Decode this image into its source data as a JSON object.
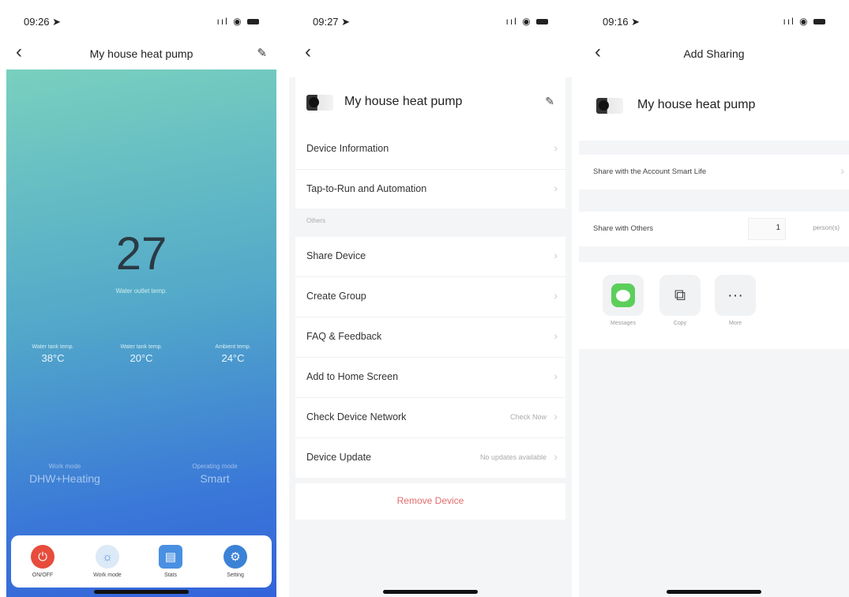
{
  "screen1": {
    "status": {
      "time": "09:26 ➤"
    },
    "nav": {
      "title": "My house heat pump"
    },
    "temperature": "27",
    "temperature_sublabel": "Water outlet temp.",
    "metrics": [
      {
        "label": "Water tank temp.",
        "value": "38°C"
      },
      {
        "label": "Water tank temp.",
        "value": "20°C"
      },
      {
        "label": "Ambient temp.",
        "value": "24°C"
      }
    ],
    "modes": [
      {
        "label": "Work mode",
        "value": "DHW+Heating"
      },
      {
        "label": "Operating mode",
        "value": "Smart"
      }
    ],
    "tabs": [
      {
        "label": "ON/OFF",
        "color": "#e74c3c"
      },
      {
        "label": "Work mode",
        "color": "#dce9f7"
      },
      {
        "label": "Stats",
        "color": "#4a90e2"
      },
      {
        "label": "Setting",
        "color": "#3b82d6"
      }
    ]
  },
  "screen2": {
    "status": {
      "time": "09:27 ➤"
    },
    "device_name": "My house heat pump",
    "items_top": [
      {
        "label": "Device Information"
      },
      {
        "label": "Tap-to-Run and Automation"
      }
    ],
    "section_title": "Others",
    "items_others": [
      {
        "label": "Share Device",
        "value": ""
      },
      {
        "label": "Create Group",
        "value": ""
      },
      {
        "label": "FAQ & Feedback",
        "value": ""
      },
      {
        "label": "Add to Home Screen",
        "value": ""
      },
      {
        "label": "Check Device Network",
        "value": "Check Now"
      },
      {
        "label": "Device Update",
        "value": "No updates available"
      }
    ],
    "remove_label": "Remove Device",
    "remove_color": "#e36b6b"
  },
  "screen3": {
    "status": {
      "time": "09:16 ➤"
    },
    "nav": {
      "title": "Add Sharing"
    },
    "device_name": "My house heat pump",
    "share_account_label": "Share with the Account Smart Life",
    "share_others_label": "Share with Others",
    "share_count": "1",
    "share_unit": "person(s)",
    "share_apps": [
      {
        "label": "Messages",
        "icon": "messages-icon"
      },
      {
        "label": "Copy",
        "icon": "copy-icon"
      },
      {
        "label": "More",
        "icon": "more-icon"
      }
    ]
  }
}
